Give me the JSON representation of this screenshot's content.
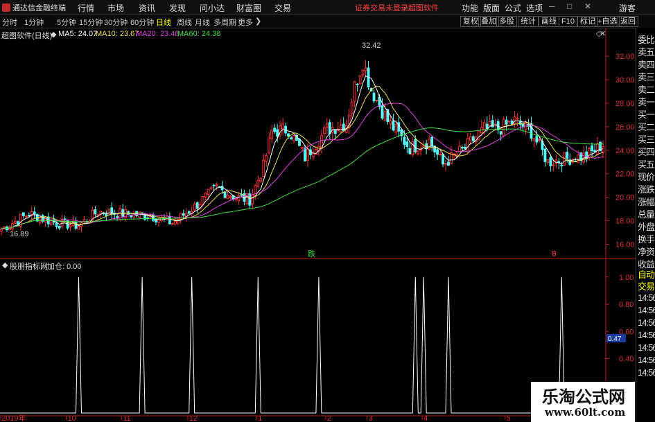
{
  "app": {
    "title": "通达信金融终端"
  },
  "menu": {
    "items": [
      "行情",
      "市场",
      "资讯",
      "发现",
      "问小达",
      "财富圈",
      "交易"
    ],
    "notice": "证券交易未登录",
    "notice_link": "超图软件",
    "right_items": [
      "功能",
      "版面",
      "公式",
      "选项"
    ],
    "guest": "游客"
  },
  "periods": [
    "分时",
    "1分钟",
    "5分钟",
    "15分钟",
    "30分钟",
    "60分钟",
    "日线",
    "周线",
    "月线",
    "多周期",
    "更多"
  ],
  "active_period": "日线",
  "toolbar_right": [
    "复权",
    "叠加",
    "多股",
    "统计",
    "画线",
    "F10",
    "标记",
    "+自选",
    "返回"
  ],
  "right_column": [
    "委比",
    "卖五",
    "卖四",
    "卖三",
    "卖二",
    "卖一",
    "买一",
    "买二",
    "买三",
    "买四",
    "买五",
    "现价",
    "涨跌",
    "涨幅",
    "总量",
    "外盘",
    "换手",
    "净资",
    "收益",
    "自动",
    "交易",
    "14:56",
    "14:56",
    "14:56",
    "14:56",
    "14:56",
    "14:56",
    "14:56"
  ],
  "main_panel": {
    "stock_label": "超图软件(日线)",
    "ma": [
      {
        "label": "MA5: 24.07",
        "color": "#ffffff"
      },
      {
        "label": "MA10: 23.67",
        "color": "#f0e050"
      },
      {
        "label": "MA20: 23.48",
        "color": "#e040e0"
      },
      {
        "label": "MA60: 24.38",
        "color": "#40e040"
      }
    ],
    "high_label": "32.42",
    "low_label": "16.89",
    "marker_die": "跌",
    "marker_8": "8"
  },
  "sub_panel": {
    "indicator_name": "股朋指标网",
    "value_label": "加仓: 0.00",
    "current_value": "0.47"
  },
  "x_axis": [
    "2019年",
    "10",
    "11",
    "12",
    "1",
    "2",
    "3",
    "4",
    "5"
  ],
  "watermark": {
    "title": "乐淘公式网",
    "url": "www.60lt.com"
  },
  "colors": {
    "up": "#ff3232",
    "down": "#54ffff",
    "axis": "#c02020",
    "notice": "#ff4040",
    "active_period": "#ffff00"
  },
  "chart_data": [
    {
      "type": "candlestick",
      "title": "超图软件(日线)",
      "ylim": [
        15.2,
        33.6
      ],
      "y_ticks": [
        16.0,
        18.0,
        20.0,
        22.0,
        24.0,
        26.0,
        28.0,
        30.0,
        32.0
      ],
      "y_tick_labels": [
        "16.00",
        "18.00",
        "20.00",
        "22.00",
        "24.00",
        "26.00",
        "28.00",
        "30.00",
        "32.00"
      ],
      "x_labels": [
        "2019年",
        "10",
        "11",
        "12",
        "1",
        "2",
        "3",
        "4",
        "5"
      ],
      "close_keypoints": [
        [
          0,
          17.3
        ],
        [
          10,
          18.6
        ],
        [
          20,
          17.8
        ],
        [
          28,
          17.6
        ],
        [
          35,
          18.8
        ],
        [
          45,
          18.6
        ],
        [
          55,
          18.4
        ],
        [
          62,
          17.8
        ],
        [
          70,
          19.2
        ],
        [
          78,
          20.8
        ],
        [
          85,
          20.0
        ],
        [
          90,
          19.8
        ],
        [
          95,
          22.6
        ],
        [
          98,
          25.6
        ],
        [
          104,
          25.8
        ],
        [
          110,
          23.4
        ],
        [
          118,
          25.8
        ],
        [
          125,
          26.3
        ],
        [
          128,
          29.4
        ],
        [
          131,
          31.6
        ],
        [
          134,
          29.2
        ],
        [
          140,
          26.5
        ],
        [
          148,
          24.2
        ],
        [
          155,
          24.8
        ],
        [
          160,
          22.8
        ],
        [
          168,
          24.2
        ],
        [
          175,
          25.8
        ],
        [
          180,
          25.8
        ],
        [
          186,
          26.5
        ],
        [
          192,
          25.6
        ],
        [
          198,
          23.0
        ],
        [
          205,
          23.3
        ],
        [
          212,
          23.5
        ],
        [
          218,
          24.5
        ]
      ],
      "series": [
        {
          "name": "MA5"
        },
        {
          "name": "MA10"
        },
        {
          "name": "MA20"
        },
        {
          "name": "MA60"
        }
      ],
      "high": 32.42,
      "low": 16.89
    },
    {
      "type": "line",
      "title": "股朋指标网",
      "ylim": [
        0,
        1.05
      ],
      "y_ticks": [
        0.2,
        0.4,
        0.6,
        0.8,
        1.0
      ],
      "y_tick_labels": [
        "0.20",
        "0.40",
        "0.60",
        "0.80",
        "1.00"
      ],
      "spike_positions": [
        28,
        51,
        69,
        93,
        115,
        150,
        153,
        162,
        203
      ],
      "spike_value": 1.0,
      "baseline": 0.0
    }
  ]
}
